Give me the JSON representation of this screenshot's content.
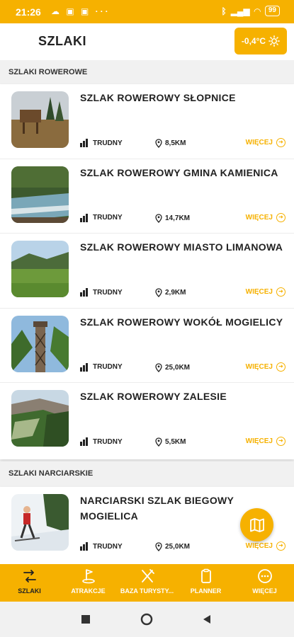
{
  "status_bar": {
    "time": "21:26",
    "battery": "99"
  },
  "header": {
    "title": "SZLAKI",
    "temperature": "-0,4°C"
  },
  "sections": [
    {
      "label": "SZLAKI ROWEROWE",
      "trails": [
        {
          "title": "SZLAK ROWEROWY SŁOPNICE",
          "difficulty": "TRUDNY",
          "distance": "8,5KM",
          "more": "WIĘCEJ"
        },
        {
          "title": "SZLAK ROWEROWY GMINA KAMIENICA",
          "difficulty": "TRUDNY",
          "distance": "14,7KM",
          "more": "WIĘCEJ"
        },
        {
          "title": "SZLAK ROWEROWY MIASTO LIMANOWA",
          "difficulty": "TRUDNY",
          "distance": "2,9KM",
          "more": "WIĘCEJ"
        },
        {
          "title": "SZLAK ROWEROWY WOKÓŁ MOGIELICY",
          "difficulty": "TRUDNY",
          "distance": "25,0KM",
          "more": "WIĘCEJ"
        },
        {
          "title": "SZLAK ROWEROWY ZALESIE",
          "difficulty": "TRUDNY",
          "distance": "5,5KM",
          "more": "WIĘCEJ"
        }
      ]
    },
    {
      "label": "SZLAKI NARCIARSKIE",
      "trails": [
        {
          "title": "NARCIARSKI SZLAK BIEGOWY MOGIELICA",
          "difficulty": "TRUDNY",
          "distance": "25,0KM",
          "more": "WIĘCEJ"
        }
      ]
    }
  ],
  "bottom_nav": [
    {
      "label": "SZLAKI",
      "icon": "route-icon",
      "active": true
    },
    {
      "label": "ATRAKCJE",
      "icon": "flag-icon",
      "active": false
    },
    {
      "label": "BAZA TURYSTY...",
      "icon": "cutlery-icon",
      "active": false
    },
    {
      "label": "PLANNER",
      "icon": "clipboard-icon",
      "active": false
    },
    {
      "label": "WIĘCEJ",
      "icon": "more-icon",
      "active": false
    }
  ],
  "colors": {
    "accent": "#f6b100",
    "text": "#222222",
    "background": "#f1f1f1"
  }
}
